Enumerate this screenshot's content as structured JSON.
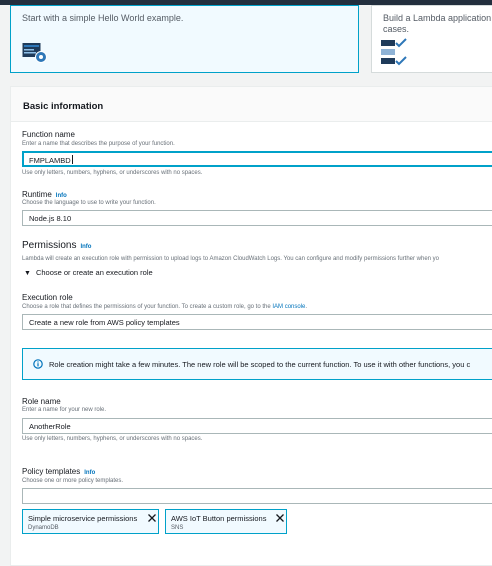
{
  "blueprints": {
    "hello_world_text": "Start with a simple Hello World example.",
    "lambda_app_text": "Build a Lambda application fron\ncases."
  },
  "basic_info": {
    "title": "Basic information",
    "function_name": {
      "label": "Function name",
      "description": "Enter a name that describes the purpose of your function.",
      "value": "FMPLAMBD",
      "hint": "Use only letters, numbers, hyphens, or underscores with no spaces."
    },
    "runtime": {
      "label": "Runtime",
      "info": "Info",
      "description": "Choose the language to use to write your function.",
      "value": "Node.js 8.10"
    },
    "permissions": {
      "title": "Permissions",
      "info": "Info",
      "description": "Lambda will create an execution role with permission to upload logs to Amazon CloudWatch Logs. You can configure and modify permissions further when yo",
      "expander": "Choose or create an execution role"
    },
    "execution_role": {
      "label": "Execution role",
      "description_prefix": "Choose a role that defines the permissions of your function. To create a custom role, go to the ",
      "description_link": "IAM console",
      "description_suffix": ".",
      "value": "Create a new role from AWS policy templates"
    },
    "alert": {
      "text": "Role creation might take a few minutes. The new role will be scoped to the current function. To use it with other functions, you c"
    },
    "role_name": {
      "label": "Role name",
      "description": "Enter a name for your new role.",
      "value": "AnotherRole",
      "hint": "Use only letters, numbers, hyphens, or underscores with no spaces."
    },
    "policy_templates": {
      "label": "Policy templates",
      "info": "Info",
      "description": "Choose one or more policy templates.",
      "value": "",
      "tokens": [
        {
          "label": "Simple microservice permissions",
          "sub": "DynamoDB"
        },
        {
          "label": "AWS IoT Button permissions",
          "sub": "SNS"
        }
      ]
    }
  },
  "colors": {
    "accent": "#00a1c9",
    "selected_bg": "#f1faff",
    "link": "#0073bb",
    "topbar": "#232f3e"
  }
}
